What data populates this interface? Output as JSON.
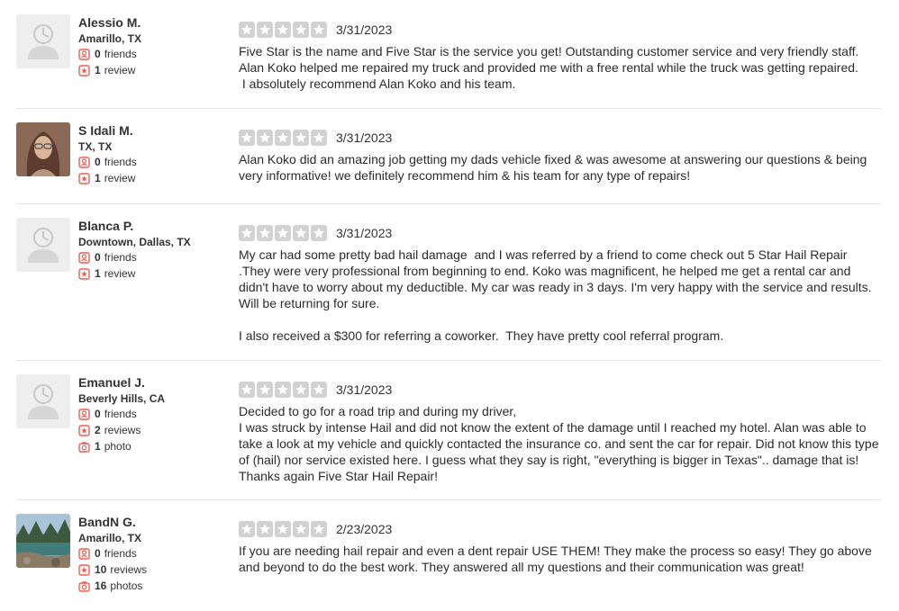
{
  "colors": {
    "accent": "#f15c4f",
    "star_gray": "#d2d2d2",
    "divider": "#e6e6e6"
  },
  "icons": {
    "friends": "friends-icon",
    "reviews": "review-star-icon",
    "photos": "camera-icon",
    "star": "star-icon",
    "avatar_placeholder": "default-avatar-icon"
  },
  "reviews": [
    {
      "name": "Alessio M.",
      "location": "Amarillo, TX",
      "friends_count": "0",
      "friends_label": "friends",
      "reviews_count": "1",
      "reviews_label": "review",
      "rating": 5,
      "date": "3/31/2023",
      "text": "Five Star is the name and Five Star is the service you get! Outstanding customer service and very friendly staff. Alan Koko helped me repaired my truck and provided me with a free rental while the truck was getting repaired.\n I absolutely recommend Alan Koko and his team."
    },
    {
      "name": "S Idali M.",
      "location": "TX, TX",
      "friends_count": "0",
      "friends_label": "friends",
      "reviews_count": "1",
      "reviews_label": "review",
      "rating": 5,
      "date": "3/31/2023",
      "text": "Alan Koko did an amazing job getting my dads vehicle fixed & was awesome at answering our questions & being very informative! we definitely recommend him & his team for any type of repairs!"
    },
    {
      "name": "Blanca P.",
      "location": "Downtown, Dallas, TX",
      "friends_count": "0",
      "friends_label": "friends",
      "reviews_count": "1",
      "reviews_label": "review",
      "rating": 5,
      "date": "3/31/2023",
      "text": "My car had some pretty bad hail damage  and I was referred by a friend to come check out 5 Star Hail Repair .They were very professional from beginning to end. Koko was magnificent, he helped me get a rental car and didn't have to worry about my deductible. My car was ready in 3 days. I'm very happy with the service and results.  Will be returning for sure.\n\nI also received a $300 for referring a coworker.  They have pretty cool referral program."
    },
    {
      "name": "Emanuel J.",
      "location": "Beverly Hills, CA",
      "friends_count": "0",
      "friends_label": "friends",
      "reviews_count": "2",
      "reviews_label": "reviews",
      "photos_count": "1",
      "photos_label": "photo",
      "rating": 5,
      "date": "3/31/2023",
      "text": "Decided to go for a road trip and during my driver,\nI was struck by intense Hail and did not know the extent of the damage until I reached my hotel. Alan was able to take a look at my vehicle and quickly contacted the insurance co. and sent the car for repair. Did not know this type of (hail) nor service existed here. I guess what they say is right, \"everything is bigger in Texas\".. damage that is! Thanks again Five Star Hail Repair!"
    },
    {
      "name": "BandN G.",
      "location": "Amarillo, TX",
      "friends_count": "0",
      "friends_label": "friends",
      "reviews_count": "10",
      "reviews_label": "reviews",
      "photos_count": "16",
      "photos_label": "photos",
      "rating": 5,
      "date": "2/23/2023",
      "text": "If you are needing hail repair and even a dent repair USE THEM! They make the process so easy! They go above and beyond to do the best work. They answered all my questions and their communication was great!"
    }
  ]
}
